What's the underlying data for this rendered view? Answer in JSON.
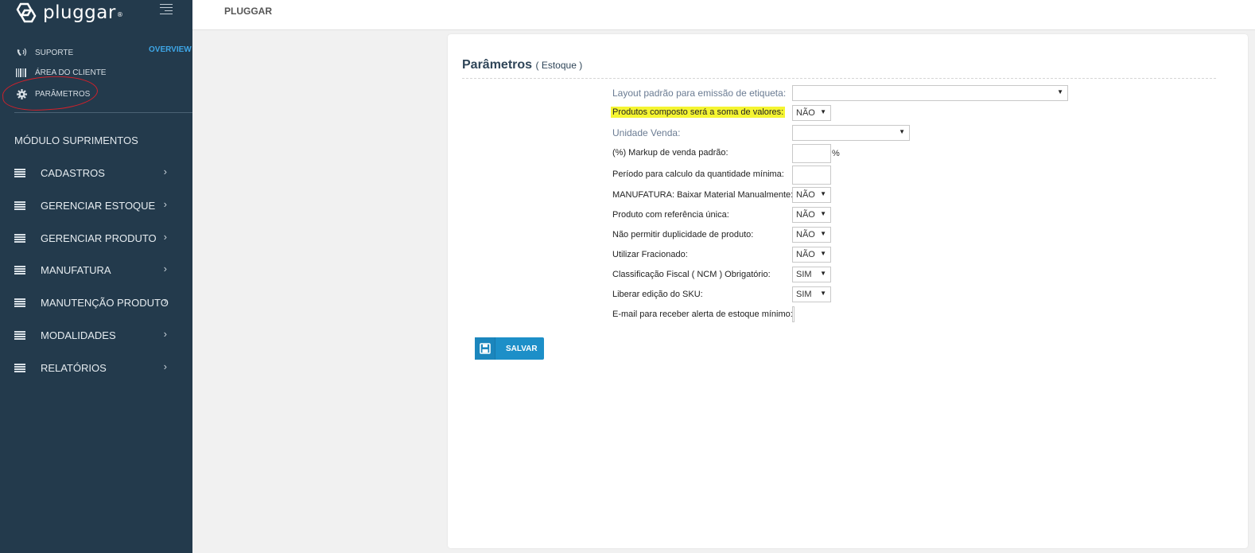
{
  "app": {
    "logo_text": "pluggar",
    "logo_mark": "®"
  },
  "sidebar": {
    "top_links": [
      {
        "label": "SUPORTE",
        "icon": "phone-icon"
      },
      {
        "label": "ÁREA DO CLIENTE",
        "icon": "barcode-icon"
      },
      {
        "label": "PARÂMETROS",
        "icon": "gear-icon"
      }
    ],
    "overview": "OVERVIEW",
    "module_title": "MÓDULO SUPRIMENTOS",
    "menu": [
      {
        "label": "CADASTROS"
      },
      {
        "label": "GERENCIAR ESTOQUE"
      },
      {
        "label": "GERENCIAR PRODUTO"
      },
      {
        "label": "MANUFATURA"
      },
      {
        "label": "MANUTENÇÃO PRODUTO"
      },
      {
        "label": "MODALIDADES"
      },
      {
        "label": "RELATÓRIOS"
      }
    ],
    "chevron": "›"
  },
  "header": {
    "title": "PLUGGAR"
  },
  "card": {
    "title": "Parâmetros",
    "subtitle": "( Estoque )"
  },
  "form": {
    "layout_label": "Layout padrão para emissão de etiqueta:",
    "layout_value": "",
    "composto_label": "Produtos composto será a soma de valores:",
    "composto_value": "NÃO",
    "unidade_label": "Unidade Venda:",
    "unidade_value": "",
    "markup_label": "(%) Markup de venda padrão:",
    "markup_value": "",
    "markup_unit": "%",
    "periodo_label": "Período para calculo da quantidade mínima:",
    "periodo_value": "",
    "manufatura_label": "MANUFATURA: Baixar Material Manualmente:",
    "manufatura_value": "NÃO",
    "referencia_label": "Produto com referência única:",
    "referencia_value": "NÃO",
    "duplicidade_label": "Não permitir duplicidade de produto:",
    "duplicidade_value": "NÃO",
    "fracionado_label": "Utilizar Fracionado:",
    "fracionado_value": "NÃO",
    "ncm_label": "Classificação Fiscal ( NCM ) Obrigatório:",
    "ncm_value": "SIM",
    "sku_label": "Liberar edição do SKU:",
    "sku_value": "SIM",
    "email_label": "E-mail para receber alerta de estoque mínimo:",
    "email_value": ""
  },
  "actions": {
    "save_label": "SALVAR"
  },
  "colors": {
    "sidebar_bg": "#233a4c",
    "accent": "#1d8fc8",
    "overview": "#3ea6e6",
    "highlight": "#f5f531",
    "annotation": "#d3202a"
  }
}
